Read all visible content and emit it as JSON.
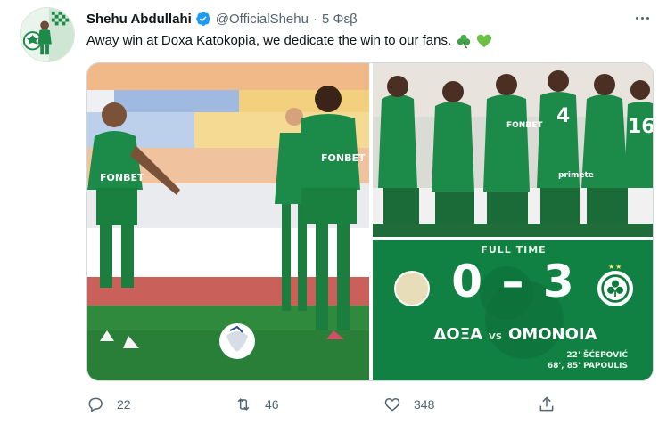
{
  "tweet": {
    "author": {
      "display_name": "Shehu Abdullahi",
      "handle": "@OfficialShehu",
      "verified": true,
      "avatar_icon": "player-photo-avatar"
    },
    "separator": "·",
    "time": "5 Φεβ",
    "text": "Away win at Doxa Katokopia, we dedicate the win to our fans.",
    "emojis": [
      "shamrock-icon",
      "green-heart-icon"
    ],
    "accent_color": "#1d9bf0",
    "club_green": "#0f7a3e"
  },
  "scoreboard": {
    "full_time": "FULL TIME",
    "score": "0 – 3",
    "home_team": "ΔΟΞΑ",
    "vs": "VS",
    "away_team": "ΟΜΟΝΟΙΑ",
    "scorers": [
      "22' ŠĆEPOVIĆ",
      "68', 85' PAPOULIS"
    ]
  },
  "actions": {
    "replies": "22",
    "retweets": "46",
    "likes": "348"
  }
}
